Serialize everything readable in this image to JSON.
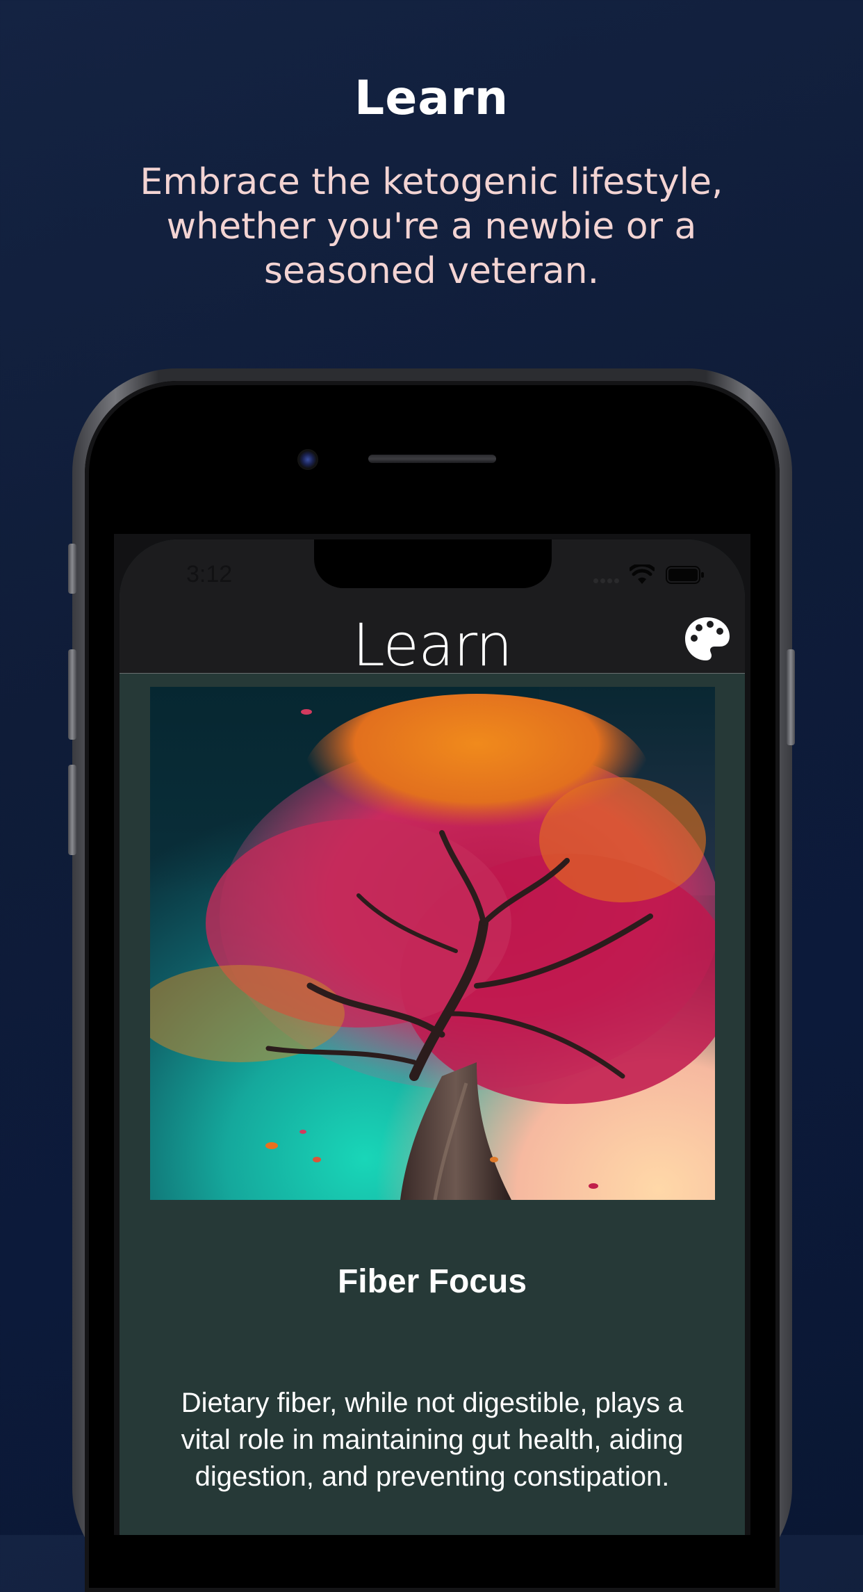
{
  "promo": {
    "title": "Learn",
    "subtitle": "Embrace the ketogenic lifestyle, whether you're a newbie or a seasoned veteran."
  },
  "status_bar": {
    "time": "3:12"
  },
  "nav": {
    "title": "Learn",
    "theme_icon": "palette-icon"
  },
  "card": {
    "image_icon": "tree-illustration",
    "title": "Fiber Focus",
    "body": "Dietary fiber, while not digestible, plays a vital role in maintaining gut health, aiding digestion, and preventing constipation."
  },
  "colors": {
    "background": "#0f1c38",
    "subtitle": "#f3d4d3",
    "content_bg": "#263937",
    "nav_bg": "#1c1c1e"
  }
}
